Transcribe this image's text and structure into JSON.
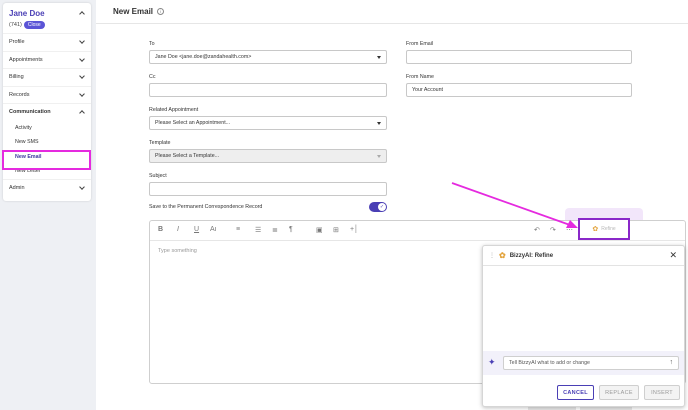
{
  "sidebar": {
    "user_name": "Jane Doe",
    "user_id": "(741)",
    "close_label": "Close",
    "items": [
      {
        "label": "Profile"
      },
      {
        "label": "Appointments"
      },
      {
        "label": "Billing"
      },
      {
        "label": "Records"
      },
      {
        "label": "Communication"
      }
    ],
    "sub_items": [
      {
        "label": "Activity"
      },
      {
        "label": "New SMS"
      },
      {
        "label": "New Email"
      },
      {
        "label": "New Letter"
      }
    ],
    "admin_label": "Admin"
  },
  "header": {
    "title": "New Email",
    "info_icon": "i"
  },
  "form": {
    "to_label": "To",
    "to_value": "Jane Doe <jane.doe@zandahealth.com>",
    "cc_label": "Cc",
    "from_email_label": "From Email",
    "from_name_label": "From Name",
    "from_name_value": "Your Account",
    "related_label": "Related Appointment",
    "related_value": "Please Select an Appointment...",
    "template_label": "Template",
    "template_value": "Please Select a Template...",
    "subject_label": "Subject",
    "save_record_label": "Save to the Permanent Correspondence Record",
    "save_record_on": true
  },
  "editor": {
    "placeholder": "Type something",
    "toolbar": {
      "bold": "B",
      "italic": "I",
      "underline": "U",
      "font_size": "Aı",
      "align": "≡",
      "list": "☰",
      "indent": "≣",
      "paragraph": "¶",
      "image": "▣",
      "table": "⊞",
      "insert": "+│",
      "undo": "↶",
      "redo": "↷",
      "more": "⋯"
    },
    "refine_label": "Refine"
  },
  "bizzy_panel": {
    "title": "BizzyAI: Refine",
    "grip": "⋮",
    "close": "✕",
    "ask_placeholder": "Tell BizzyAI what to add or change",
    "send": "↑",
    "cancel_label": "CANCEL",
    "replace_label": "REPLACE",
    "insert_label": "INSERT"
  },
  "colors": {
    "accent": "#4a3fb5",
    "highlight_magenta": "#e52adf",
    "highlight_purple": "#8a28c9"
  }
}
